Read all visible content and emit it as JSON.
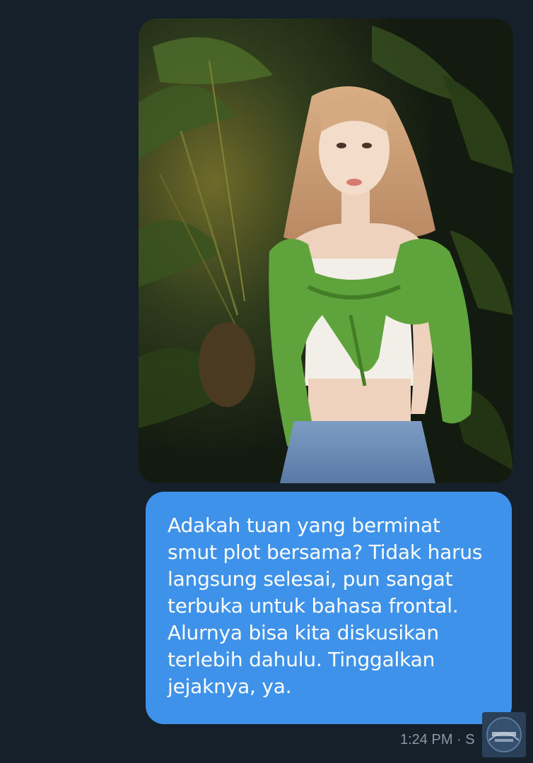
{
  "conversation": {
    "image_message": {
      "alt_icon": "photo-of-person-in-green-sweater"
    },
    "text_message": {
      "text": "Adakah tuan yang berminat\nsmut plot bersama? Tidak harus\nlangsung selesai, pun sangat\nterbuka untuk bahasa frontal.\nAlurnya bisa kita diskusikan\nterlebih dahulu. Tinggalkan\njejaknya, ya.",
      "bubble_color": "#3f92ea"
    },
    "meta": {
      "time": "1:24 PM",
      "separator": "·",
      "status_partial": "S"
    }
  },
  "watermark": {
    "icon": "base-logo-watermark-icon"
  },
  "theme": {
    "background": "#15202b",
    "meta_color": "#8b98a5"
  }
}
